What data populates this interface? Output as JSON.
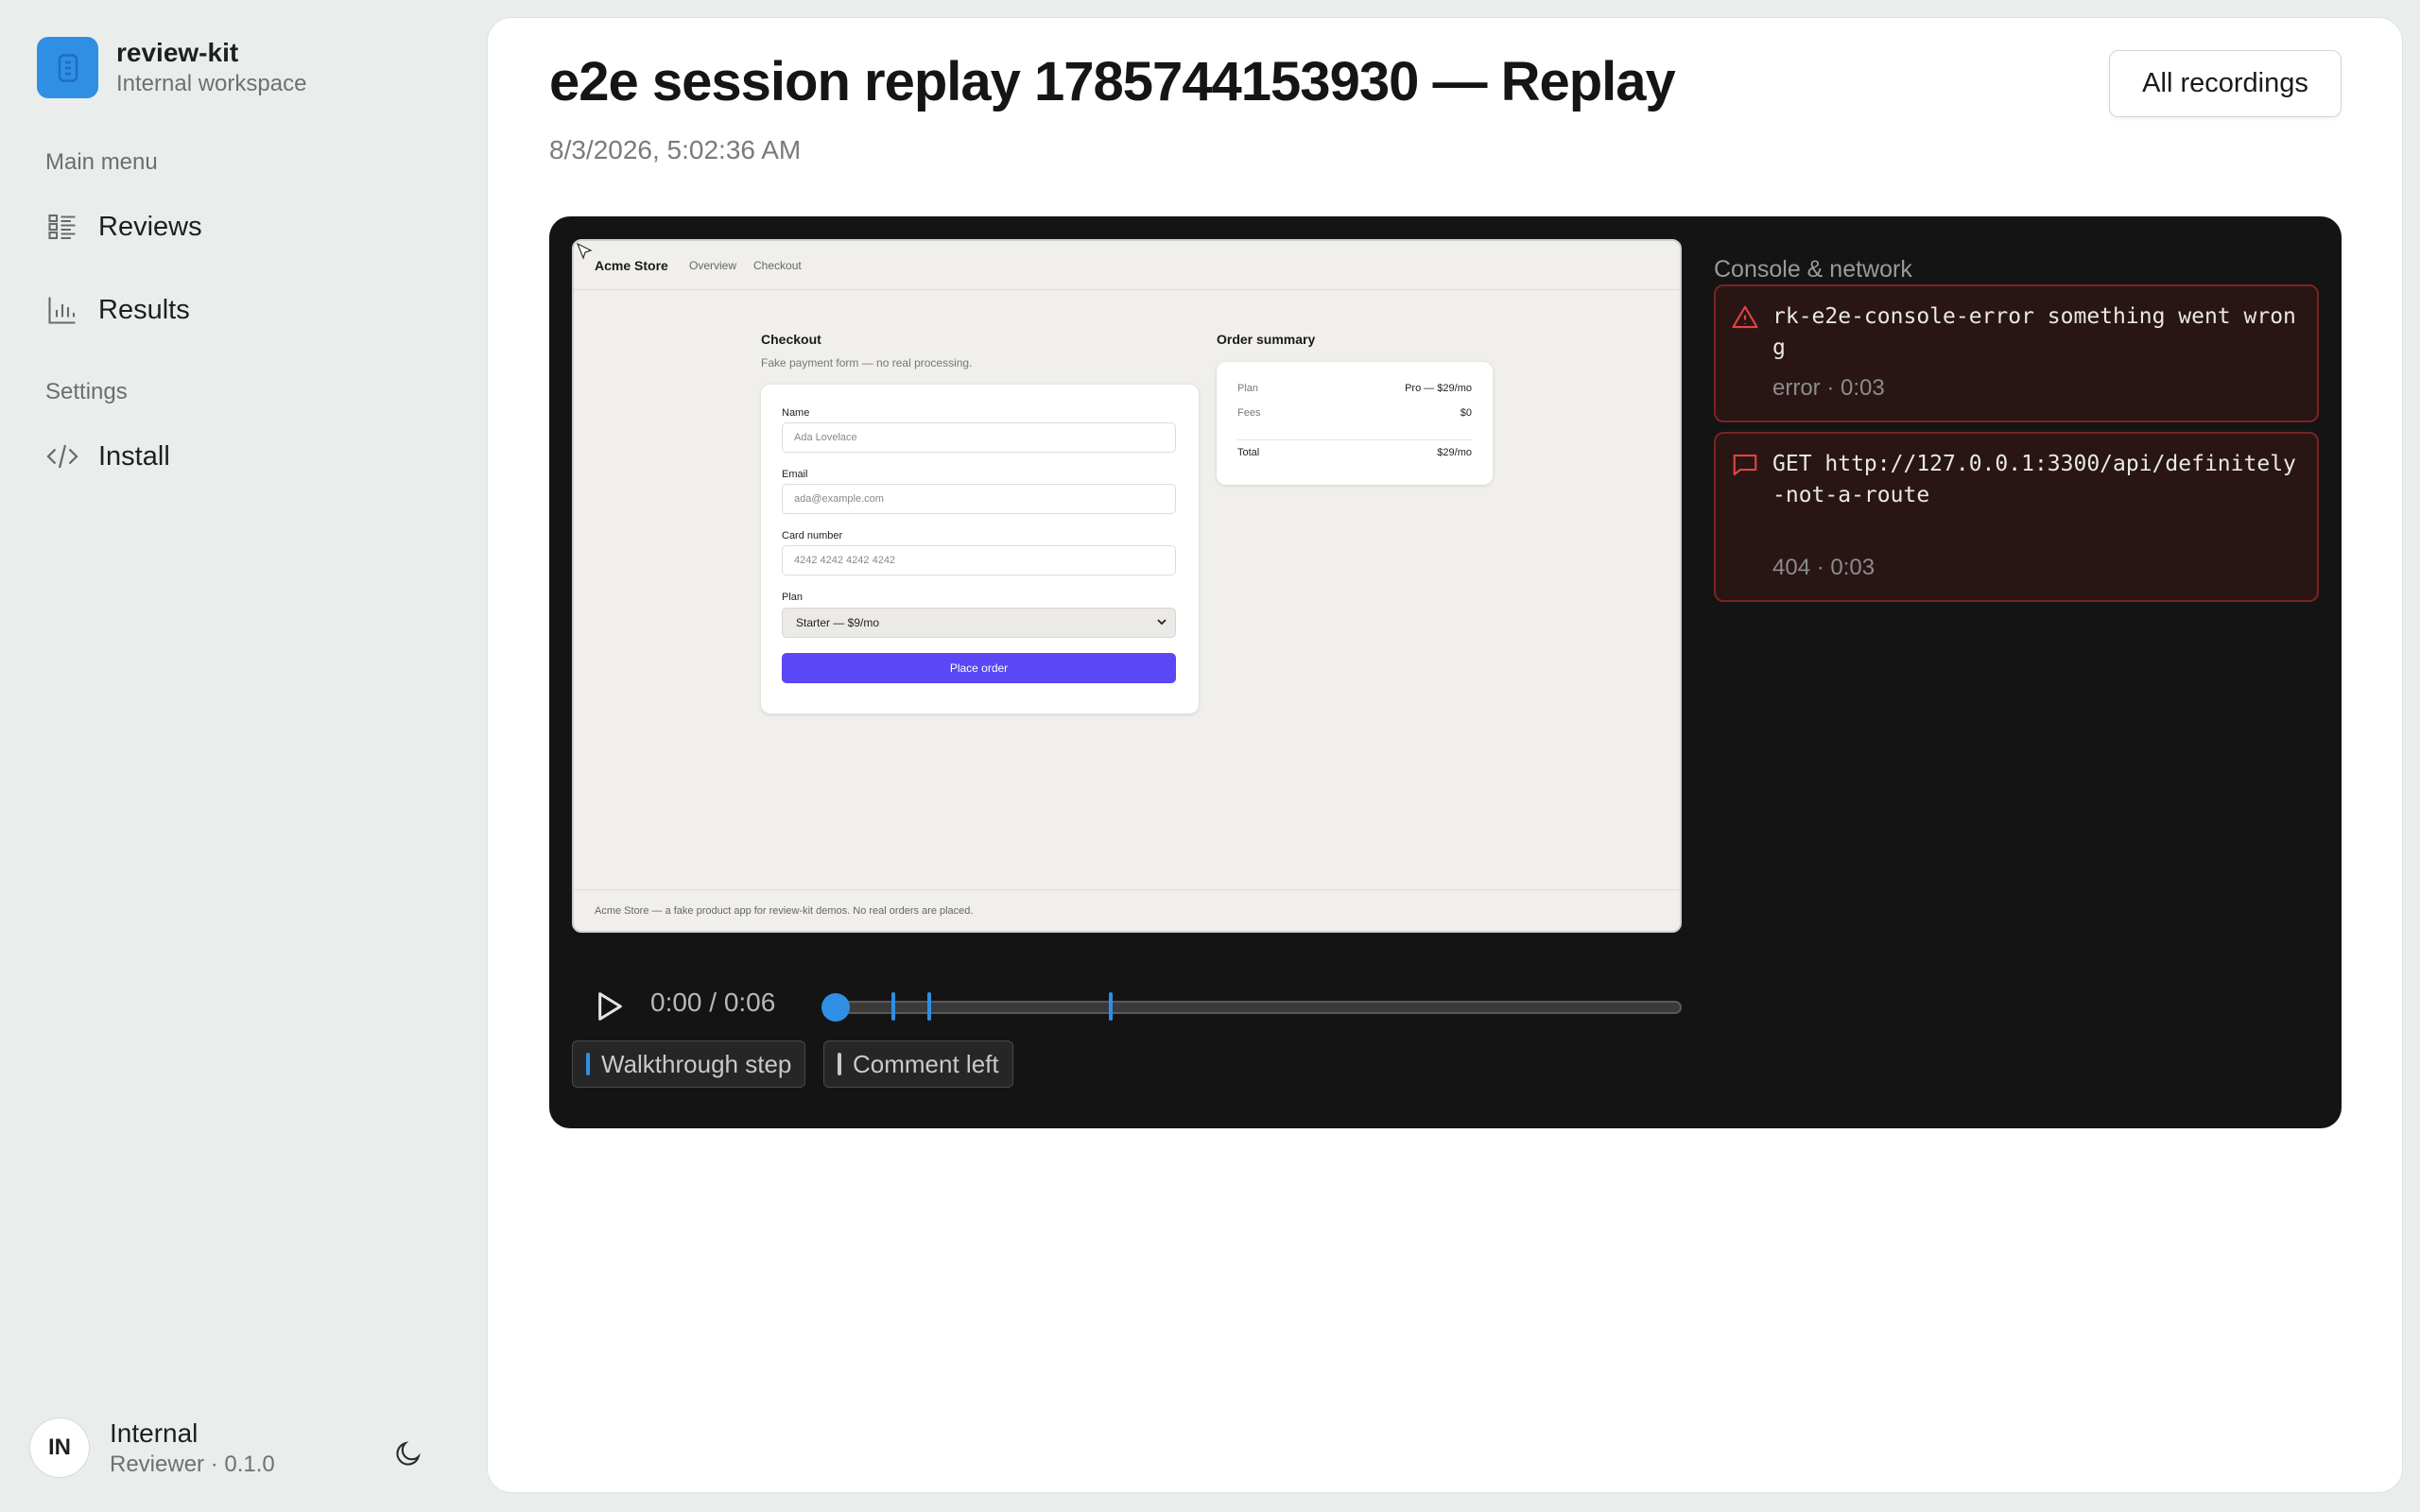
{
  "sidebar": {
    "brand_name": "review-kit",
    "brand_sub": "Internal workspace",
    "main_menu_label": "Main menu",
    "items": [
      {
        "label": "Reviews",
        "icon": "list-icon"
      },
      {
        "label": "Results",
        "icon": "bar-chart-icon"
      }
    ],
    "settings_label": "Settings",
    "settings_items": [
      {
        "label": "Install",
        "icon": "code-icon"
      }
    ],
    "user": {
      "initials": "IN",
      "name": "Internal",
      "role": "Reviewer · 0.1.0"
    }
  },
  "header": {
    "title": "e2e session replay 1785744153930 — Replay",
    "date": "8/3/2026, 5:02:36 AM",
    "all_recordings": "All recordings"
  },
  "replay": {
    "store_name": "Acme Store",
    "nav_links": [
      "Overview",
      "Checkout"
    ],
    "checkout_title": "Checkout",
    "checkout_sub": "Fake payment form — no real processing.",
    "fields": {
      "name_label": "Name",
      "name_placeholder": "Ada Lovelace",
      "email_label": "Email",
      "email_placeholder": "ada@example.com",
      "card_label": "Card number",
      "card_placeholder": "4242 4242 4242 4242",
      "plan_label": "Plan",
      "plan_value": "Starter — $9/mo"
    },
    "place_order": "Place order",
    "summary_title": "Order summary",
    "summary": {
      "plan_label": "Plan",
      "plan_value": "Pro — $29/mo",
      "fees_label": "Fees",
      "fees_value": "$0",
      "total_label": "Total",
      "total_value": "$29/mo"
    },
    "footer": "Acme Store — a fake product app for review-kit demos. No real orders are placed."
  },
  "controls": {
    "time": "0:00 / 0:06",
    "progress": 0,
    "markers_seconds": [
      0.6,
      0.8,
      1.9
    ],
    "legend": [
      {
        "label": "Walkthrough step",
        "color": "#2f8fe5"
      },
      {
        "label": "Comment left",
        "color": "#c9c9c9"
      }
    ]
  },
  "console": {
    "title": "Console & network",
    "entries": [
      {
        "type": "error",
        "icon": "warning-triangle-icon",
        "message": "rk-e2e-console-error something went wrong",
        "meta": "error · 0:03"
      },
      {
        "type": "network",
        "icon": "message-icon",
        "message": "GET http://127.0.0.1:3300/api/definitely-not-a-route",
        "meta": "404 · 0:03"
      }
    ]
  },
  "colors": {
    "accent": "#2f8fe5",
    "primary_button": "#5b47f5",
    "error_border": "#7a2323",
    "error_bg": "#2a1515",
    "error_icon": "#e0463f"
  }
}
